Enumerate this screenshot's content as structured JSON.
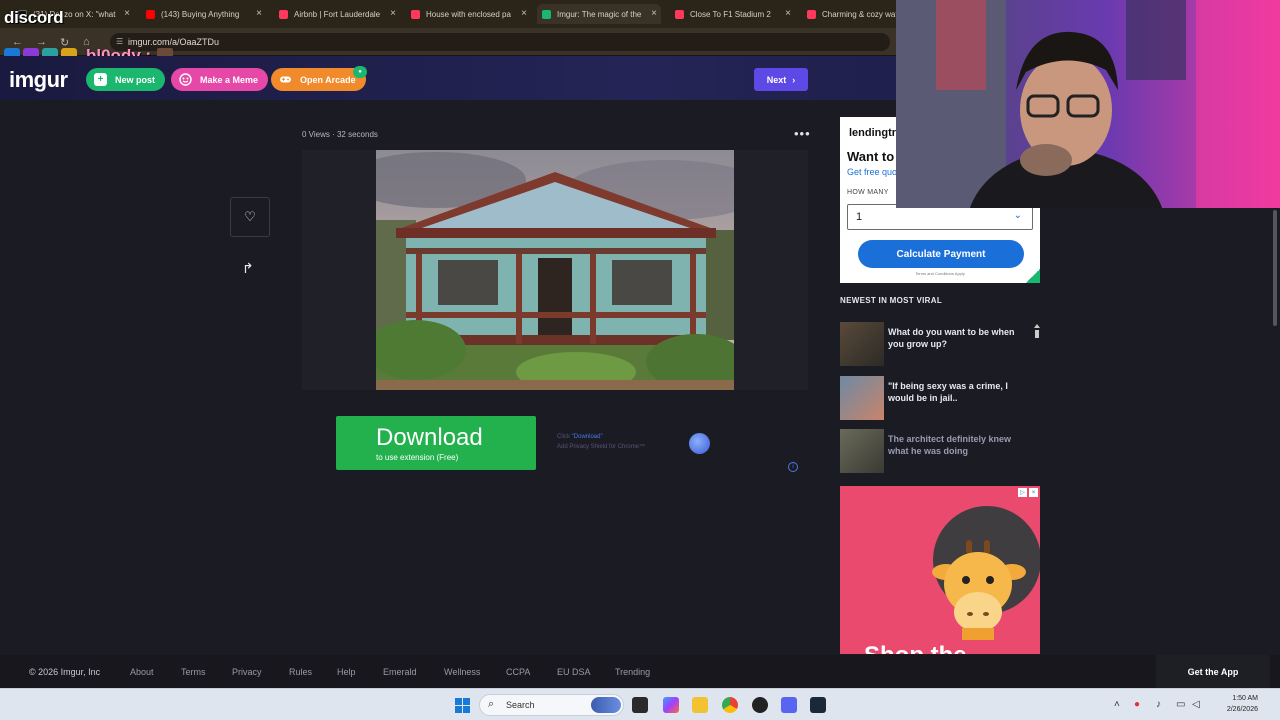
{
  "browser": {
    "tabs": [
      {
        "label": "(31) Denzo on X: \"what",
        "color": "#111111"
      },
      {
        "label": "(143) Buying Anything",
        "color": "#ff0000"
      },
      {
        "label": "Airbnb | Fort Lauderdale",
        "color": "#ff385c"
      },
      {
        "label": "House with enclosed pa",
        "color": "#ff385c"
      },
      {
        "label": "Imgur: The magic of the",
        "color": "#1bb76e"
      },
      {
        "label": "Close To F1 Stadium 2",
        "color": "#ff385c"
      },
      {
        "label": "Charming & cozy wat",
        "color": "#ff385c"
      }
    ],
    "close_glyph": "×",
    "url": "imgur.com/a/OaaZTDu"
  },
  "overlay": {
    "discord": "discord",
    "username": "bl0ody :"
  },
  "header": {
    "logo": "imgur",
    "new_post": "New post",
    "new_post_icon": "+",
    "make_meme": "Make a Meme",
    "open_arcade": "Open Arcade",
    "next": "Next",
    "next_chevron": "›"
  },
  "post": {
    "meta": "0 Views · 32 seconds",
    "more_icon": "•••",
    "heart_icon": "♡",
    "share_icon": "↱"
  },
  "download_ad": {
    "title": "Download",
    "subtitle": "to use extension (Free)",
    "note_prefix": "Click",
    "note_link": "\"Download\"",
    "note_line2": "Add Privacy Shield for Chrome™",
    "info": "i"
  },
  "lending_ad": {
    "logo": "lendingtre",
    "heading": "Want to",
    "sub": "Get free quo",
    "how_many": "HOW MANY",
    "select_value": "1",
    "select_chevron": "⌄",
    "button": "Calculate Payment",
    "terms": "Terms and Conditions Apply"
  },
  "viral": {
    "title": "NEWEST IN MOST VIRAL",
    "items": [
      {
        "title": "What do you want to be when you grow up?"
      },
      {
        "title": "\"If being sexy was a crime, I would be in jail.."
      },
      {
        "title": "The architect definitely knew what he was doing"
      }
    ]
  },
  "giraffe_ad": {
    "shop_text": "Shop the"
  },
  "footer": {
    "copyright": "© 2026 Imgur, Inc",
    "links": [
      "About",
      "Terms",
      "Privacy",
      "Rules",
      "Help",
      "Emerald",
      "Wellness",
      "CCPA",
      "EU DSA",
      "Trending"
    ],
    "get_app": "Get the App"
  },
  "taskbar": {
    "search": "Search",
    "time": "1:50 AM",
    "date": "2/26/2026"
  }
}
